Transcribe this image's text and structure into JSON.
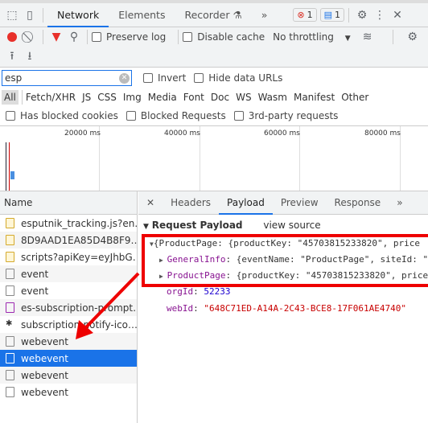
{
  "toolbar": {
    "tabs": [
      "Network",
      "Elements",
      "Recorder"
    ],
    "more": "»",
    "errors": "1",
    "messages": "1"
  },
  "controls": {
    "preserve_log": "Preserve log",
    "disable_cache": "Disable cache",
    "throttling": "No throttling"
  },
  "filter": {
    "value": "esp",
    "invert": "Invert",
    "hide_data_urls": "Hide data URLs"
  },
  "types": [
    "All",
    "Fetch/XHR",
    "JS",
    "CSS",
    "Img",
    "Media",
    "Font",
    "Doc",
    "WS",
    "Wasm",
    "Manifest",
    "Other"
  ],
  "checks": [
    "Has blocked cookies",
    "Blocked Requests",
    "3rd-party requests"
  ],
  "overview": {
    "ticks": [
      "20000 ms",
      "40000 ms",
      "60000 ms",
      "80000 ms"
    ]
  },
  "list": {
    "header": "Name",
    "items": [
      {
        "name": "esputnik_tracking.js?en…",
        "type": "js"
      },
      {
        "name": "8D9AAD1EA85D4B8F9…",
        "type": "js"
      },
      {
        "name": "scripts?apiKey=eyJhbG…",
        "type": "js"
      },
      {
        "name": "event",
        "type": "doc"
      },
      {
        "name": "event",
        "type": "doc"
      },
      {
        "name": "es-subscription-prompt…",
        "type": "img"
      },
      {
        "name": "subscription-notify-ico…",
        "type": "icon"
      },
      {
        "name": "webevent",
        "type": "doc"
      },
      {
        "name": "webevent",
        "type": "doc",
        "selected": true
      },
      {
        "name": "webevent",
        "type": "doc"
      },
      {
        "name": "webevent",
        "type": "doc"
      }
    ]
  },
  "detail": {
    "tabs": [
      "Headers",
      "Payload",
      "Preview",
      "Response"
    ],
    "active": "Payload",
    "more": "»",
    "section": "Request Payload",
    "view_source": "view source",
    "root": "{ProductPage: {productKey: \"45703815233820\", price",
    "general_key": "GeneralInfo",
    "general_val": "{eventName: \"ProductPage\", siteId: \"",
    "product_key": "ProductPage",
    "product_val": "{productKey: \"45703815233820\", price",
    "org_key": "orgId",
    "org_val": "52233",
    "web_key": "webId",
    "web_val": "\"648C71ED-A14A-2C43-BCE8-17F061AE4740\""
  },
  "annotation_color": "#e00000"
}
